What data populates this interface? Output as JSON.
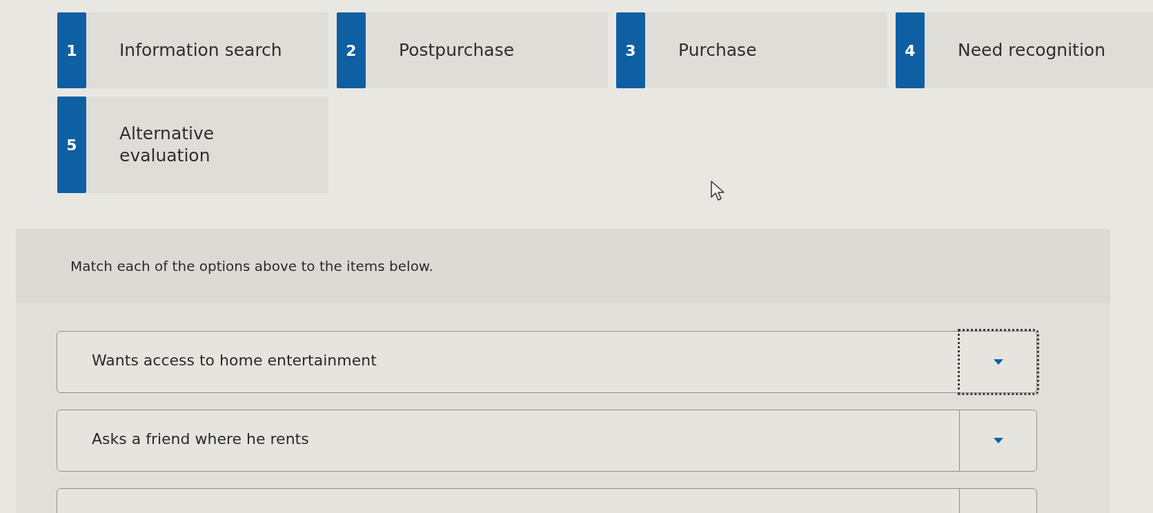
{
  "options": [
    {
      "number": "1",
      "label": "Information search"
    },
    {
      "number": "2",
      "label": "Postpurchase"
    },
    {
      "number": "3",
      "label": "Purchase"
    },
    {
      "number": "4",
      "label": "Need recognition"
    },
    {
      "number": "5",
      "label": "Alternative evaluation"
    }
  ],
  "instructions": "Match each of the options above to the items below.",
  "items": [
    {
      "text": "Wants access to home entertainment",
      "focused": true
    },
    {
      "text": "Asks a friend where he rents",
      "focused": false
    },
    {
      "focused": false
    }
  ]
}
